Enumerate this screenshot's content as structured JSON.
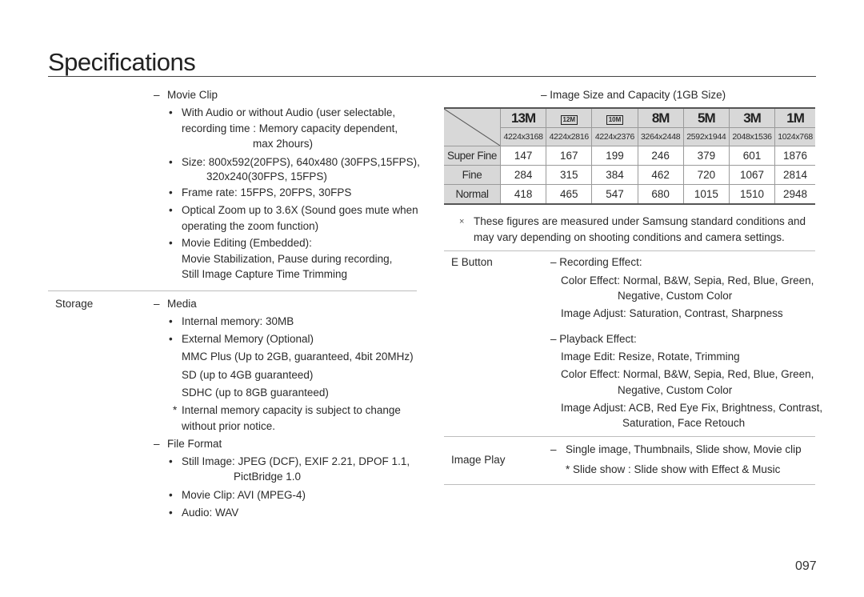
{
  "page": {
    "title": "Specifications",
    "page_number": "097"
  },
  "left": {
    "movie_clip": {
      "heading": "Movie Clip",
      "audio_line1": "With Audio or without Audio (user selectable,",
      "audio_line2": "recording time : Memory capacity dependent,",
      "audio_line3": "max 2hours)",
      "size_line1": "Size: 800x592(20FPS), 640x480 (30FPS,15FPS),",
      "size_line2": "320x240(30FPS, 15FPS)",
      "frame_rate": "Frame rate: 15FPS, 20FPS, 30FPS",
      "zoom_line1": "Optical Zoom up to 3.6X (Sound goes mute when",
      "zoom_line2": "operating the zoom function)",
      "editing_line1": "Movie Editing (Embedded):",
      "editing_line2": "Movie Stabilization, Pause during recording,",
      "editing_line3": "Still Image Capture Time Trimming"
    },
    "storage": {
      "label": "Storage",
      "media_heading": "Media",
      "internal": "Internal memory: 30MB",
      "external": "External Memory (Optional)",
      "mmc": "MMC Plus (Up to 2GB, guaranteed, 4bit 20MHz)",
      "sd": "SD (up to 4GB guaranteed)",
      "sdhc": "SDHC (up to 8GB guaranteed)",
      "note_line1": "Internal memory capacity is subject to change",
      "note_line2": "without prior notice.",
      "note_mark": "*",
      "file_format_heading": "File Format",
      "still_line1": "Still Image: JPEG (DCF), EXIF 2.21, DPOF 1.1,",
      "still_line2": "PictBridge 1.0",
      "movie": "Movie Clip: AVI (MPEG-4)",
      "audio": "Audio: WAV"
    }
  },
  "right": {
    "capacity": {
      "heading": "– Image Size and Capacity (1GB Size)",
      "columns": [
        {
          "icon": "13M",
          "resolution": "4224x3168"
        },
        {
          "icon": "12M",
          "resolution": "4224x2816"
        },
        {
          "icon": "10M",
          "resolution": "4224x2376"
        },
        {
          "icon": "8M",
          "resolution": "3264x2448"
        },
        {
          "icon": "5M",
          "resolution": "2592x1944"
        },
        {
          "icon": "3M",
          "resolution": "2048x1536"
        },
        {
          "icon": "1M",
          "resolution": "1024x768"
        }
      ],
      "rows": [
        {
          "label": "Super Fine",
          "values": [
            "147",
            "167",
            "199",
            "246",
            "379",
            "601",
            "1876"
          ]
        },
        {
          "label": "Fine",
          "values": [
            "284",
            "315",
            "384",
            "462",
            "720",
            "1067",
            "2814"
          ]
        },
        {
          "label": "Normal",
          "values": [
            "418",
            "465",
            "547",
            "680",
            "1015",
            "1510",
            "2948"
          ]
        }
      ],
      "note_mark": "×",
      "note_line1": "These figures are measured under Samsung standard conditions and",
      "note_line2": "may vary depending on shooting conditions and camera settings."
    },
    "e_button": {
      "label": "E Button",
      "recording_heading": "– Recording Effect:",
      "rec_color_line1": "Color Effect: Normal, B&W, Sepia, Red, Blue, Green,",
      "rec_color_line2": "Negative, Custom Color",
      "rec_adjust": "Image Adjust: Saturation, Contrast, Sharpness",
      "playback_heading": "– Playback Effect:",
      "pb_edit": "Image Edit: Resize, Rotate, Trimming",
      "pb_color_line1": "Color Effect: Normal, B&W, Sepia, Red, Blue, Green,",
      "pb_color_line2": "Negative, Custom Color",
      "pb_adjust_line1": "Image Adjust: ACB, Red Eye Fix, Brightness, Contrast,",
      "pb_adjust_line2": "Saturation, Face Retouch"
    },
    "image_play": {
      "label": "Image Play",
      "modes": "Single image, Thumbnails, Slide show, Movie clip",
      "slideshow_note": "* Slide show : Slide show with Effect & Music"
    }
  }
}
